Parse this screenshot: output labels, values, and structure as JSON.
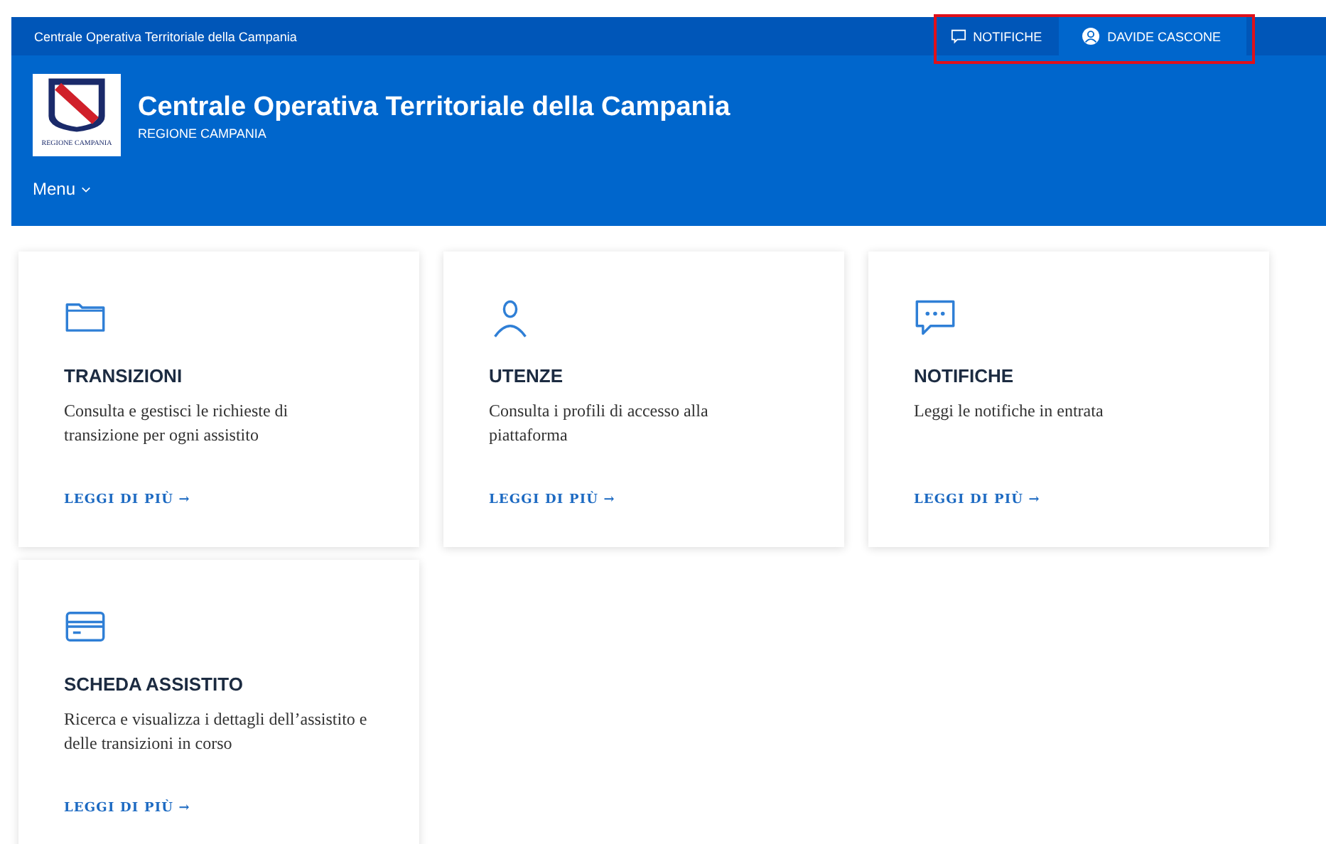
{
  "top_bar": {
    "title": "Centrale Operativa Territoriale della Campania",
    "notifications": {
      "label": "NOTIFICHE"
    },
    "user": {
      "label": "DAVIDE CASCONE"
    },
    "highlighted": true
  },
  "header": {
    "logo_caption": "REGIONE CAMPANIA",
    "title": "Centrale Operativa Territoriale della Campania",
    "subtitle": "REGIONE CAMPANIA",
    "menu": "Menu"
  },
  "cards": [
    {
      "kind": "folder",
      "title": "TRANSIZIONI",
      "text": "Consulta e gestisci le richieste di transizione per ogni assistito",
      "link": "LEGGI DI PIÙ →"
    },
    {
      "kind": "user",
      "title": "UTENZE",
      "text": "Consulta i profili di accesso alla piattaforma",
      "link": "LEGGI DI PIÙ →"
    },
    {
      "kind": "chat",
      "title": "NOTIFICHE",
      "text": "Leggi le notifiche in entrata",
      "link": "LEGGI DI PIÙ →"
    },
    {
      "kind": "card",
      "title": "SCHEDA ASSISTITO",
      "text": "Ricerca e visualizza i dettagli dell’assistito e delle transizioni in corso",
      "link": "LEGGI DI PIÙ →"
    }
  ]
}
